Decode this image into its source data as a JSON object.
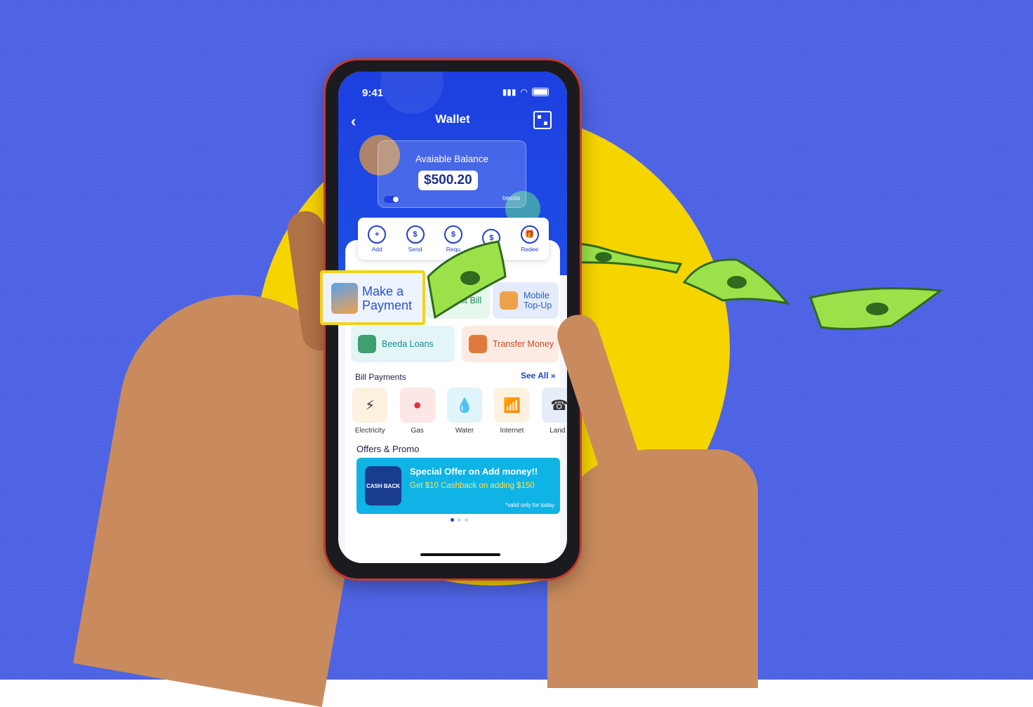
{
  "status_bar": {
    "time": "9:41"
  },
  "app": {
    "title": "Wallet"
  },
  "balance": {
    "label": "Avaiable Balance",
    "amount": "$500.20",
    "brand": "beeda"
  },
  "actions": [
    {
      "label": "Add",
      "icon": "add-card-icon"
    },
    {
      "label": "Send",
      "icon": "send-money-icon"
    },
    {
      "label": "Requ",
      "icon": "request-money-icon"
    },
    {
      "label": "",
      "icon": "pay-screen-icon"
    },
    {
      "label": "Redee",
      "icon": "gift-icon"
    }
  ],
  "tiles": {
    "make_payment": "Make a Payment",
    "split_bill": "plit Bill",
    "mobile_topup": "Mobile Top-Up",
    "loans": "Beeda Loans",
    "transfer": "Transfer Money"
  },
  "bill_payments": {
    "title": "Bill Payments",
    "see_all": "See All »",
    "items": [
      "Electricity",
      "Gas",
      "Water",
      "Internet",
      "Land l"
    ]
  },
  "offers": {
    "title": "Offers & Promo",
    "promo_title": "Special Offer on  Add money!!",
    "promo_sub": "Get $10 Cashback on adding $150",
    "promo_note": "*valid only for today",
    "promo_badge": "CASH BACK"
  },
  "colors": {
    "background": "#4d63e4",
    "accent_yellow": "#f5d400",
    "brand_blue": "#1d3fe0"
  }
}
